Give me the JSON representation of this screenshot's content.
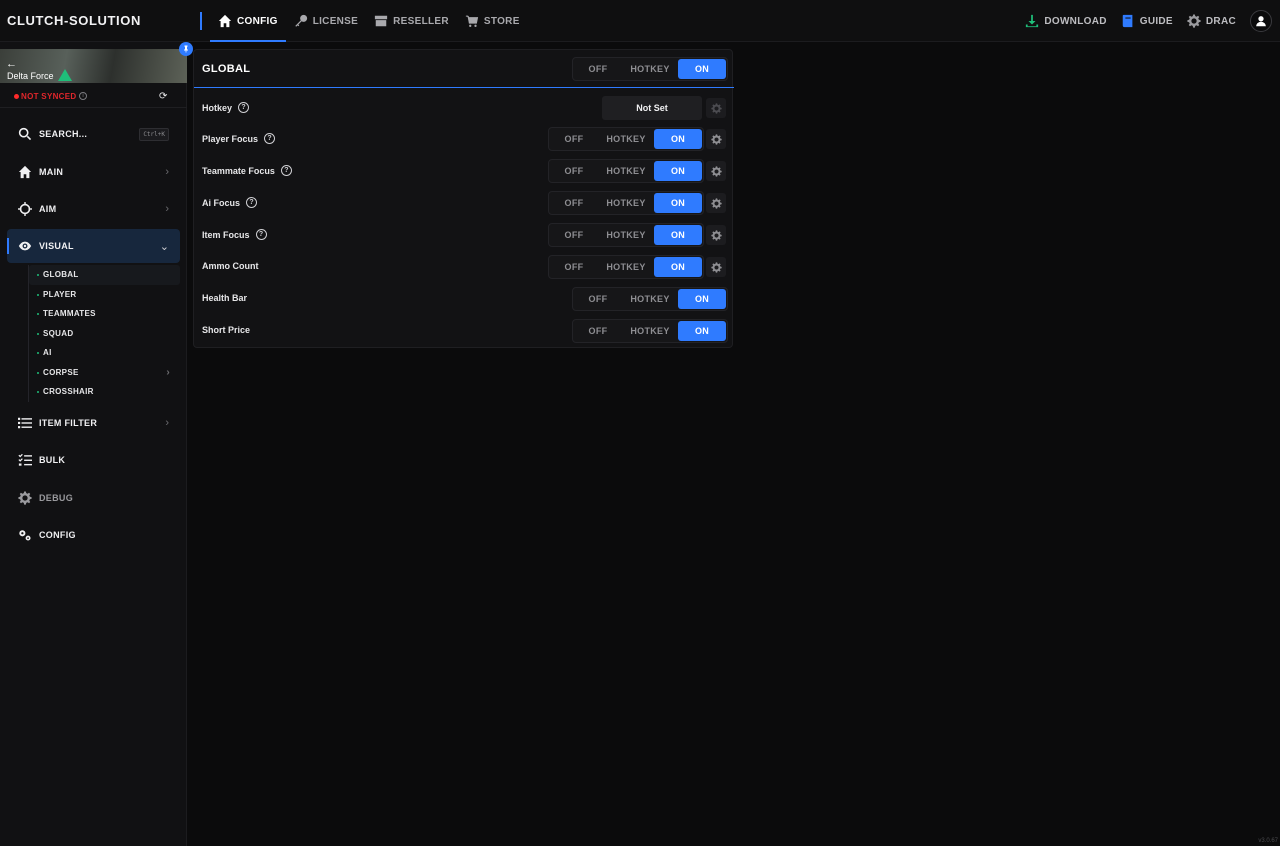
{
  "brand": "CLUTCH-SOLUTION",
  "nav": [
    {
      "label": "CONFIG",
      "icon": "home-icon",
      "active": true
    },
    {
      "label": "LICENSE",
      "icon": "key-icon",
      "active": false
    },
    {
      "label": "RESELLER",
      "icon": "store-front-icon",
      "active": false
    },
    {
      "label": "STORE",
      "icon": "cart-icon",
      "active": false
    }
  ],
  "top_right": {
    "download": "DOWNLOAD",
    "guide": "GUIDE",
    "user": "DRAC"
  },
  "colors": {
    "accent": "#2f7bff",
    "download_icon": "#1fbf7a",
    "error": "#e0262b"
  },
  "game": {
    "name": "Delta Force",
    "back": "←",
    "sync_status": "NOT SYNCED"
  },
  "sidebar": {
    "search": {
      "label": "SEARCH...",
      "shortcut": "Ctrl+K"
    },
    "items": [
      {
        "label": "MAIN"
      },
      {
        "label": "AIM"
      },
      {
        "label": "VISUAL"
      },
      {
        "label": "ITEM FILTER"
      },
      {
        "label": "BULK"
      },
      {
        "label": "DEBUG"
      },
      {
        "label": "CONFIG"
      }
    ],
    "visual_sub": [
      "GLOBAL",
      "PLAYER",
      "TEAMMATES",
      "SQUAD",
      "AI",
      "CORPSE",
      "CROSSHAIR"
    ]
  },
  "panel": {
    "title": "GLOBAL",
    "header_toggle": {
      "off": "OFF",
      "hotkey": "HOTKEY",
      "on": "ON",
      "selected": "ON"
    },
    "rows": [
      {
        "label": "Hotkey",
        "value": "Not Set"
      },
      {
        "label": "Player Focus",
        "off": "OFF",
        "hotkey": "HOTKEY",
        "on": "ON",
        "selected": "ON"
      },
      {
        "label": "Teammate Focus",
        "off": "OFF",
        "hotkey": "HOTKEY",
        "on": "ON",
        "selected": "ON"
      },
      {
        "label": "Ai Focus",
        "off": "OFF",
        "hotkey": "HOTKEY",
        "on": "ON",
        "selected": "ON"
      },
      {
        "label": "Item Focus",
        "off": "OFF",
        "hotkey": "HOTKEY",
        "on": "ON",
        "selected": "ON"
      },
      {
        "label": "Ammo Count",
        "off": "OFF",
        "hotkey": "HOTKEY",
        "on": "ON",
        "selected": "ON"
      },
      {
        "label": "Health Bar",
        "off": "OFF",
        "hotkey": "HOTKEY",
        "on": "ON",
        "selected": "ON"
      },
      {
        "label": "Short Price",
        "off": "OFF",
        "hotkey": "HOTKEY",
        "on": "ON",
        "selected": "ON"
      }
    ]
  },
  "version": "v3.0.67"
}
